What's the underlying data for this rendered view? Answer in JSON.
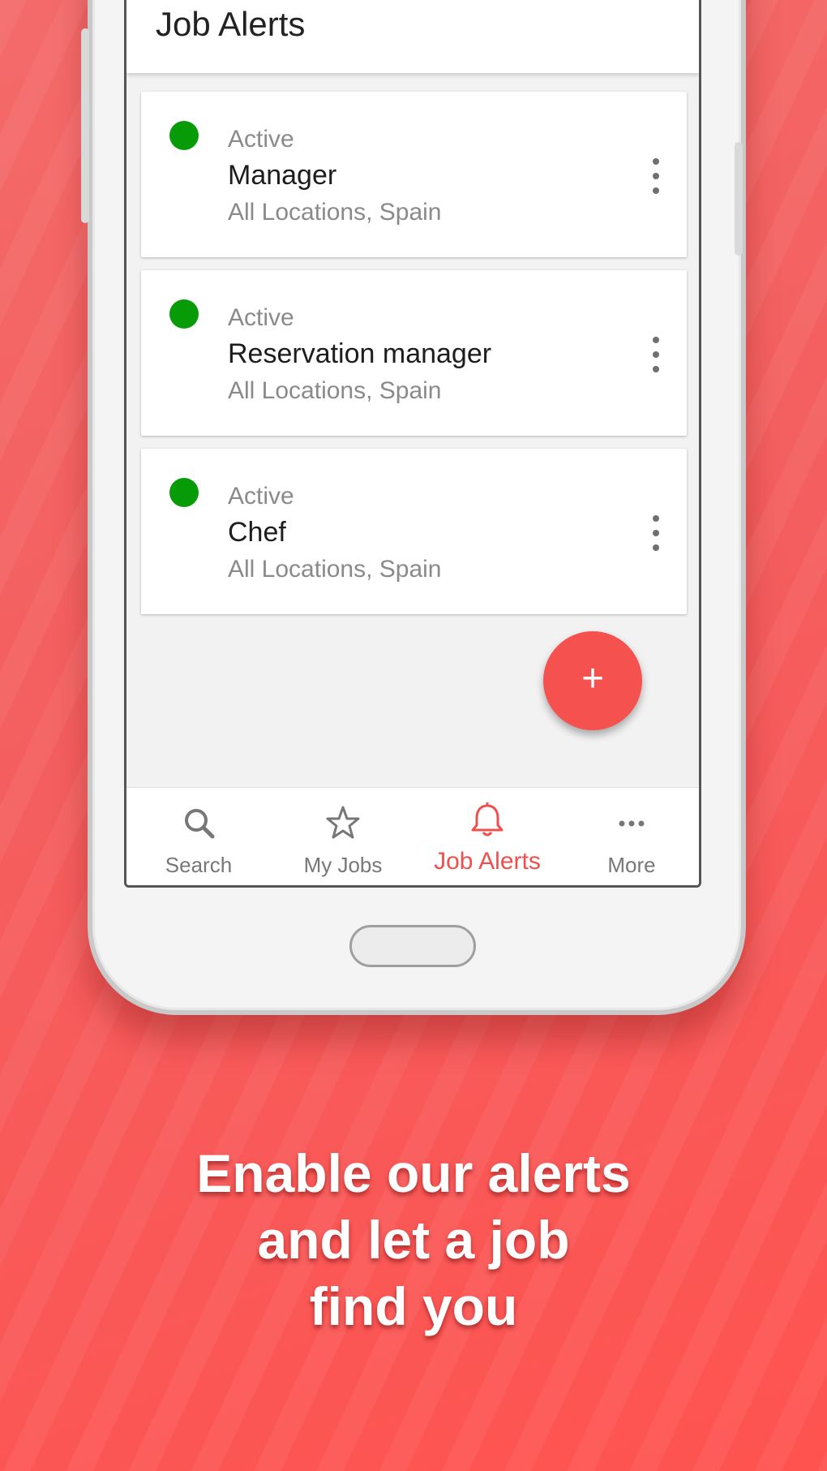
{
  "header": {
    "title": "Job Alerts"
  },
  "alerts": [
    {
      "status": "Active",
      "title": "Manager",
      "location": "All Locations, Spain"
    },
    {
      "status": "Active",
      "title": "Reservation manager",
      "location": "All Locations, Spain"
    },
    {
      "status": "Active",
      "title": "Chef",
      "location": "All Locations, Spain"
    }
  ],
  "fab": {
    "label": "+"
  },
  "nav": [
    {
      "label": "Search",
      "icon": "search-icon"
    },
    {
      "label": "My Jobs",
      "icon": "star-icon"
    },
    {
      "label": "Job Alerts",
      "icon": "bell-icon",
      "active": true
    },
    {
      "label": "More",
      "icon": "more-icon"
    }
  ],
  "tagline": [
    "Enable our alerts",
    "and let a job",
    "find you"
  ],
  "colors": {
    "accent": "#f0504d",
    "active_dot": "#079c07",
    "background": "#f45e5e"
  }
}
